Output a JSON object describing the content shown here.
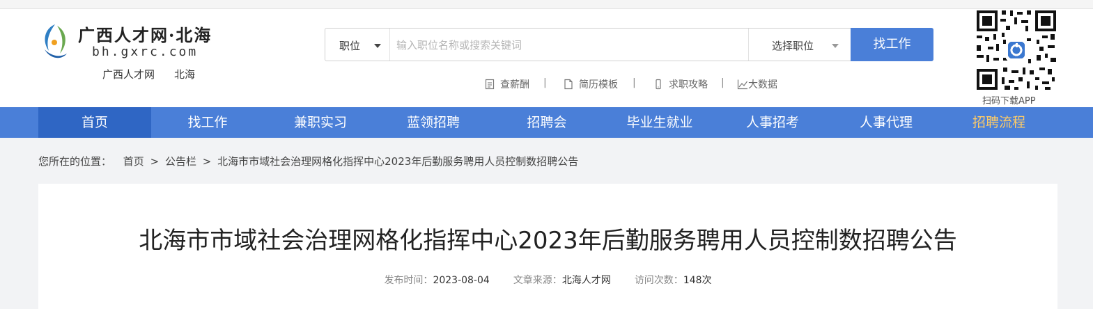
{
  "header": {
    "logo_text": "广西人才网·北海",
    "logo_domain": "bh.gxrc.com",
    "site_name": "广西人才网",
    "site_city": "北海"
  },
  "search": {
    "type_label": "职位",
    "placeholder": "输入职位名称或搜索关键词",
    "job_select_label": "选择职位",
    "button_label": "找工作"
  },
  "quick_links": [
    {
      "label": "查薪酬",
      "icon": "document-icon"
    },
    {
      "label": "简历模板",
      "icon": "file-icon"
    },
    {
      "label": "求职攻略",
      "icon": "phone-icon"
    },
    {
      "label": "大数据",
      "icon": "chart-line-icon"
    }
  ],
  "quick_links_separator": "|",
  "qr": {
    "caption": "扫码下载APP"
  },
  "nav": {
    "items": [
      {
        "label": "首页",
        "active": true
      },
      {
        "label": "找工作"
      },
      {
        "label": "兼职实习"
      },
      {
        "label": "蓝领招聘"
      },
      {
        "label": "招聘会"
      },
      {
        "label": "毕业生就业"
      },
      {
        "label": "人事招考"
      },
      {
        "label": "人事代理"
      },
      {
        "label": "招聘流程",
        "highlight": true
      }
    ]
  },
  "breadcrumb": {
    "prefix": "您所在的位置：",
    "items": [
      "首页",
      "公告栏",
      "北海市市域社会治理网格化指挥中心2023年后勤服务聘用人员控制数招聘公告"
    ],
    "separator": ">"
  },
  "article": {
    "title": "北海市市域社会治理网格化指挥中心2023年后勤服务聘用人员控制数招聘公告",
    "publish_label": "发布时间：",
    "publish_date": "2023-08-04",
    "source_label": "文章来源：",
    "source": "北海人才网",
    "visits_label": "访问次数：",
    "visits": "148次"
  },
  "colors": {
    "nav_bg": "#4a7fd8",
    "nav_active": "#2f66c4",
    "nav_highlight": "#ffcc66",
    "button_bg": "#4a7fd8"
  }
}
